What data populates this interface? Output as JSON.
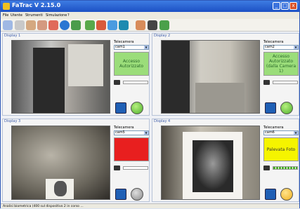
{
  "window": {
    "title": "FaTrac V 2.15.0",
    "min": "_",
    "max": "□",
    "close": "x"
  },
  "menu": [
    "File",
    "Utente",
    "Strumenti",
    "Simulazione",
    "?"
  ],
  "toolbar_icons": [
    "users-icon",
    "user-add-icon",
    "user-edit-icon",
    "user-remove-icon",
    "play-icon",
    "monitor-icon",
    "chart-icon",
    "arrows-icon",
    "cycle-icon",
    "globe-icon",
    "person-icon",
    "id-card-icon",
    "exit-icon"
  ],
  "displays": [
    {
      "title": "Display 1",
      "cam_label": "Telecamera",
      "cam_value": "cam1",
      "status": "Accesso Autorizzato",
      "status_color": "#9bdd7a",
      "light": "#4caf2a"
    },
    {
      "title": "Display 2",
      "cam_label": "Telecamera",
      "cam_value": "cam2",
      "status": "Accesso Autorizzato (dalla Camera 1)",
      "status_color": "#9bdd7a",
      "light": "#4caf2a"
    },
    {
      "title": "Display 3",
      "cam_label": "Telecamera",
      "cam_value": "cam5",
      "status": "",
      "status_color": "#e81f1f",
      "light": "#9a9a9a"
    },
    {
      "title": "Display 4",
      "cam_label": "Telecamera",
      "cam_value": "cam6",
      "status": "Palevata Foto",
      "status_color": "#f5f400",
      "light": "#f0b020"
    }
  ],
  "status_bar": "Analisi biometrica (400 sul dispositivo 2 in corso ..."
}
